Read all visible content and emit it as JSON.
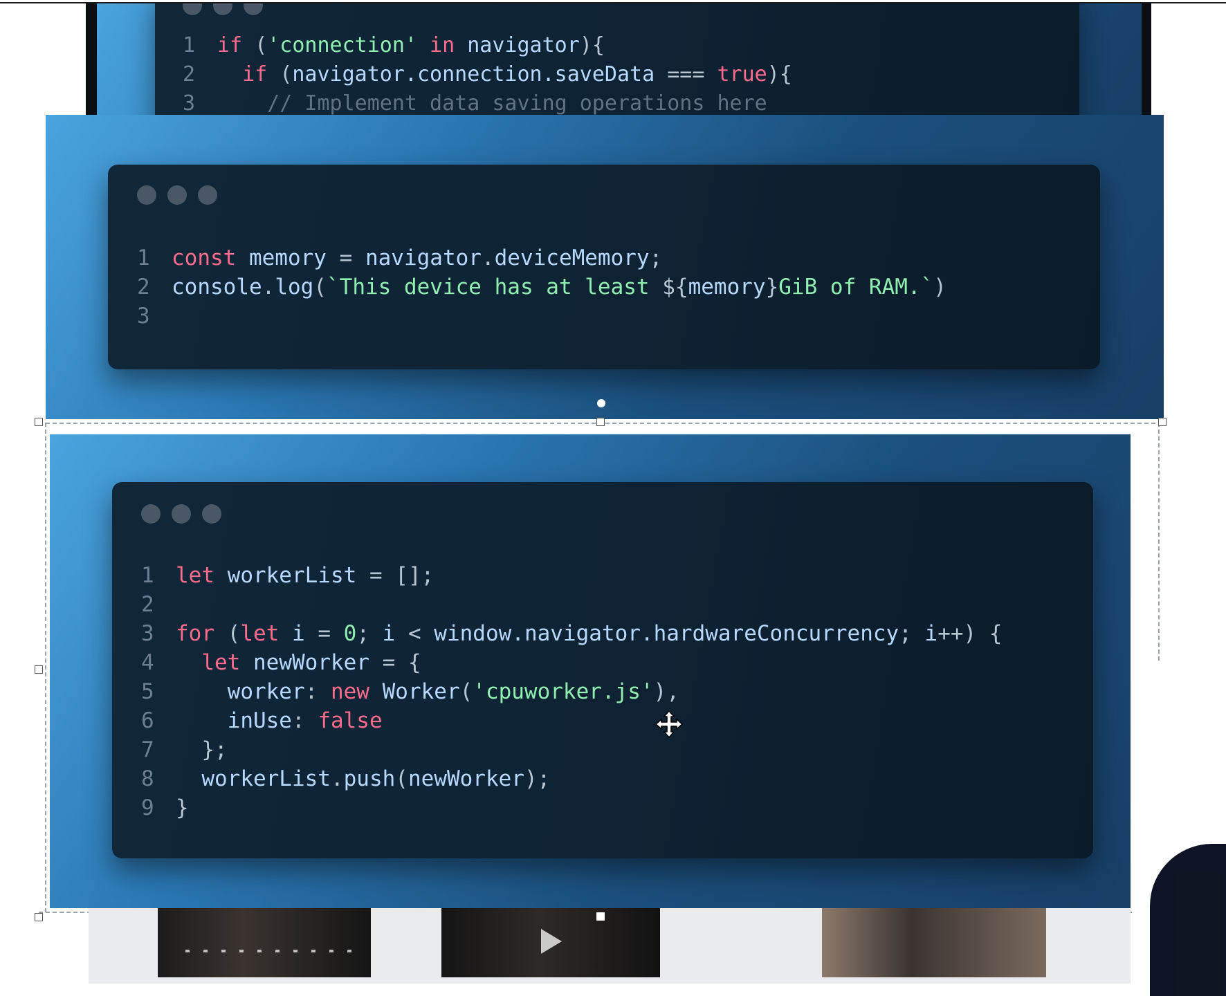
{
  "top_snippet": {
    "lines": [
      {
        "n": "1",
        "tokens": [
          [
            "kw",
            "if "
          ],
          [
            "punc",
            "("
          ],
          [
            "str",
            "'connection'"
          ],
          [
            "kw",
            " in "
          ],
          [
            "var",
            "navigator"
          ],
          [
            "punc",
            "){"
          ]
        ]
      },
      {
        "n": "2",
        "tokens": [
          [
            "text",
            "  "
          ],
          [
            "kw",
            "if "
          ],
          [
            "punc",
            "("
          ],
          [
            "var",
            "navigator.connection.saveData "
          ],
          [
            "punc",
            "=== "
          ],
          [
            "bool",
            "true"
          ],
          [
            "punc",
            "){"
          ]
        ]
      },
      {
        "n": "3",
        "tokens": [
          [
            "comment",
            "    // Implement data saving operations here"
          ]
        ]
      }
    ]
  },
  "memory_snippet": {
    "lines": [
      {
        "n": "1",
        "tokens": [
          [
            "kw",
            "const "
          ],
          [
            "var",
            "memory "
          ],
          [
            "punc",
            "= "
          ],
          [
            "var",
            "navigator"
          ],
          [
            "punc",
            "."
          ],
          [
            "var",
            "deviceMemory"
          ],
          [
            "punc",
            ";"
          ]
        ]
      },
      {
        "n": "2",
        "tokens": [
          [
            "var",
            "console"
          ],
          [
            "punc",
            "."
          ],
          [
            "var",
            "log"
          ],
          [
            "punc",
            "("
          ],
          [
            "str",
            "`This device has at least "
          ],
          [
            "punc",
            "${"
          ],
          [
            "var",
            "memory"
          ],
          [
            "punc",
            "}"
          ],
          [
            "str",
            "GiB of RAM.`"
          ],
          [
            "punc",
            ")"
          ]
        ]
      },
      {
        "n": "3",
        "tokens": []
      }
    ]
  },
  "worker_snippet": {
    "lines": [
      {
        "n": "1",
        "tokens": [
          [
            "kw",
            "let "
          ],
          [
            "var",
            "workerList "
          ],
          [
            "punc",
            "= [];"
          ]
        ]
      },
      {
        "n": "2",
        "tokens": []
      },
      {
        "n": "3",
        "tokens": [
          [
            "kw",
            "for "
          ],
          [
            "punc",
            "("
          ],
          [
            "kw",
            "let "
          ],
          [
            "var",
            "i "
          ],
          [
            "punc",
            "= "
          ],
          [
            "num",
            "0"
          ],
          [
            "punc",
            "; "
          ],
          [
            "var",
            "i "
          ],
          [
            "punc",
            "< "
          ],
          [
            "var",
            "window.navigator.hardwareConcurrency"
          ],
          [
            "punc",
            "; "
          ],
          [
            "var",
            "i"
          ],
          [
            "punc",
            "++) {"
          ]
        ]
      },
      {
        "n": "4",
        "tokens": [
          [
            "text",
            "  "
          ],
          [
            "kw",
            "let "
          ],
          [
            "var",
            "newWorker "
          ],
          [
            "punc",
            "= {"
          ]
        ]
      },
      {
        "n": "5",
        "tokens": [
          [
            "text",
            "    "
          ],
          [
            "prop",
            "worker"
          ],
          [
            "punc",
            ": "
          ],
          [
            "kw",
            "new "
          ],
          [
            "var",
            "Worker"
          ],
          [
            "punc",
            "("
          ],
          [
            "str",
            "'cpuworker.js'"
          ],
          [
            "punc",
            "),"
          ]
        ]
      },
      {
        "n": "6",
        "tokens": [
          [
            "text",
            "    "
          ],
          [
            "prop",
            "inUse"
          ],
          [
            "punc",
            ": "
          ],
          [
            "bool",
            "false"
          ]
        ]
      },
      {
        "n": "7",
        "tokens": [
          [
            "text",
            "  "
          ],
          [
            "punc",
            "};"
          ]
        ]
      },
      {
        "n": "8",
        "tokens": [
          [
            "text",
            "  "
          ],
          [
            "var",
            "workerList"
          ],
          [
            "punc",
            "."
          ],
          [
            "var",
            "push"
          ],
          [
            "punc",
            "("
          ],
          [
            "var",
            "newWorker"
          ],
          [
            "punc",
            ");"
          ]
        ]
      },
      {
        "n": "9",
        "tokens": [
          [
            "punc",
            "}"
          ]
        ]
      }
    ]
  },
  "cursor": {
    "icon": "move-cursor-icon"
  },
  "thumbnails": [
    {
      "name": "video-thumbnail-1"
    },
    {
      "name": "video-thumbnail-2",
      "icon": "play-icon"
    },
    {
      "name": "video-thumbnail-3"
    }
  ]
}
